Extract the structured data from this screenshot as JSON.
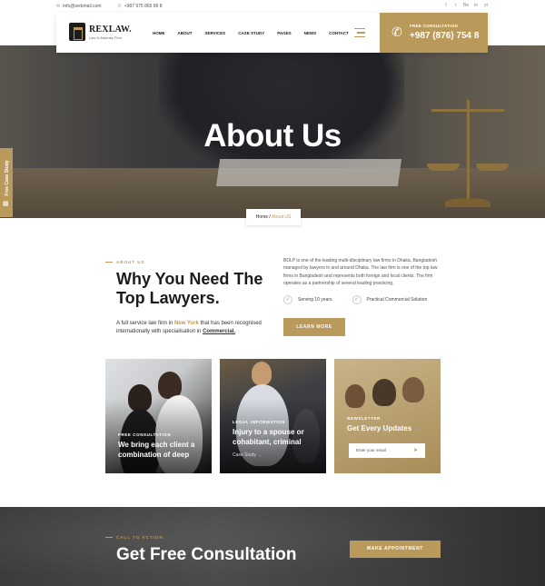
{
  "topbar": {
    "email": "info@webmail.com",
    "phone": "+987 975 865 86 8",
    "social": [
      "f",
      "t",
      "Be",
      "in",
      "yt"
    ]
  },
  "brand": {
    "name": "REXLAW.",
    "tagline": "Law & Attorney Firm"
  },
  "nav": [
    "HOME",
    "ABOUT",
    "SERVICES",
    "CASE STUDY",
    "PAGES",
    "NEWS",
    "CONTACT"
  ],
  "consultation": {
    "label": "FREE CONSULTATION",
    "phone": "+987 (876) 754 8"
  },
  "hero": {
    "title": "About Us"
  },
  "breadcrumb": {
    "home": "Home",
    "sep": " / ",
    "current": "About US"
  },
  "side_tab": {
    "label": "Free Case Study"
  },
  "about": {
    "label": "ABOUT US",
    "heading": "Why You Need The Top Lawyers.",
    "intro_pre": "A full service law firm in ",
    "intro_city": "New York",
    "intro_mid": " that has been recognised internationally with specialisation in ",
    "intro_field": "Commercial.",
    "description": "BDLP is one of the leading multi-disciplinary law firms in Dhaka, Bangladesh managed by lawyers in and around Dhaka. The law firm is one of the top law firms in Bangladesh and represents both foreign and local clients. The firm operates as a partnership of several leading practicing.",
    "checks": [
      "Serving 10 years",
      "Practical Commercial Solution"
    ],
    "button": "LEARN MORE"
  },
  "cards": [
    {
      "sub": "FREE CONSULTATION",
      "title": "We bring each client a combination of deep"
    },
    {
      "sub": "LEGAL INFORMATION",
      "title": "Injury to a spouse or cohabitant, criminal",
      "link": "Case Study"
    },
    {
      "sub": "NEWSLETTER",
      "title": "Get Every Updates",
      "input_placeholder": "Enter your email"
    }
  ],
  "cta": {
    "label": "CALL TO ACTION",
    "heading": "Get Free Consultation",
    "button": "MAKE APPOINTMENT"
  },
  "colors": {
    "accent": "#b99a5b",
    "dark": "#1b1b1b"
  }
}
